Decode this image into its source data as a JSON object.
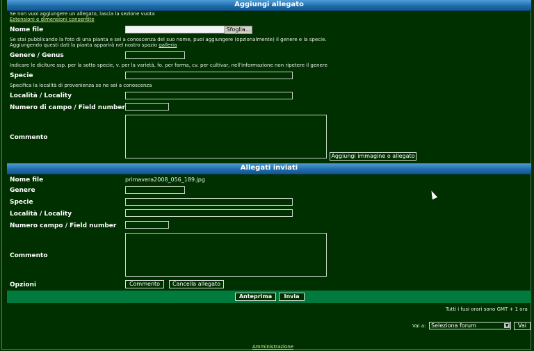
{
  "add_section": {
    "title": "Aggiungi allegato",
    "intro": "Se non vuoi aggiungere un allegato, lascia la sezione vuota",
    "ext_link": "Estensioni e dimensioni consentite",
    "file_label": "Nome file",
    "browse": "Sfoglia...",
    "photo_note_1": "Se stai pubblicando la foto di una pianta e sei a conoscenza del suo nome, puoi aggiungere (opzionalmente) il genere e la specie.",
    "photo_note_2_pre": "Aggiungendo questi dati la pianta apparirà nel nostro spazio",
    "photo_note_2_link": "galleria",
    "genus_label": "Genere / Genus",
    "species_note": "Indicare le diciture ssp. per la sotto specie, v. per la varietà, fo. per forma, cv. per cultivar, nell'informazione non ripetere il genere",
    "species_label": "Specie",
    "locality_note": "Specifica la località di provenienza se ne sei a conoscenza",
    "locality_label": "Località / Locality",
    "field_label": "Numero di campo / Field number",
    "comment_label": "Commento",
    "add_button": "Aggiungi immagine o allegato"
  },
  "sent_section": {
    "title": "Allegati inviati",
    "file_label": "Nome file",
    "file_value": "primavera2008_056_189.jpg",
    "genus_label": "Genere",
    "species_label": "Specie",
    "locality_label": "Località / Locality",
    "field_label": "Numero campo / Field number",
    "comment_label": "Commento",
    "options_label": "Opzioni",
    "comment_button": "Commento",
    "delete_button": "Cancella allegato"
  },
  "actions": {
    "preview": "Anteprima",
    "send": "Invia"
  },
  "footer": {
    "timezone": "Tutti i fusi orari sono GMT + 1 ora",
    "jump_label": "Vai a:",
    "forum_select": "Seleziona forum",
    "go": "Vai",
    "admin_link": "Amministrazione"
  },
  "colors": {
    "background": "#003000",
    "header_blue": "#1e6aa8",
    "action_bar": "#007a3d"
  }
}
